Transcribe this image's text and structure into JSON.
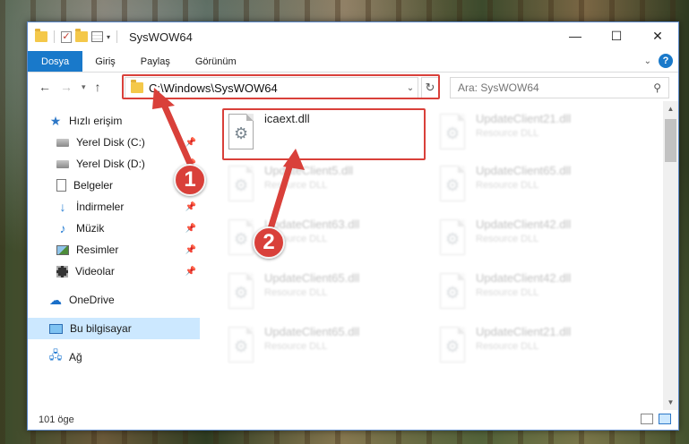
{
  "window": {
    "title": "SysWOW64"
  },
  "window_controls": {
    "minimize": "—",
    "maximize": "☐",
    "close": "✕"
  },
  "ribbon": {
    "tabs": [
      {
        "label": "Dosya"
      },
      {
        "label": "Giriş"
      },
      {
        "label": "Paylaş"
      },
      {
        "label": "Görünüm"
      }
    ],
    "help": "?"
  },
  "address": {
    "path": "C:\\Windows\\SysWOW64"
  },
  "search": {
    "placeholder": "Ara: SysWOW64"
  },
  "sidebar": {
    "items": [
      {
        "label": "Hızlı erişim",
        "icon": "star-icon"
      },
      {
        "label": "Yerel Disk (C:)",
        "icon": "drive-icon",
        "pinned": true
      },
      {
        "label": "Yerel Disk (D:)",
        "icon": "drive-icon",
        "pinned": true
      },
      {
        "label": "Belgeler",
        "icon": "document-icon",
        "pinned": true
      },
      {
        "label": "İndirmeler",
        "icon": "download-icon",
        "pinned": true
      },
      {
        "label": "Müzik",
        "icon": "music-icon",
        "pinned": true
      },
      {
        "label": "Resimler",
        "icon": "pictures-icon",
        "pinned": true
      },
      {
        "label": "Videolar",
        "icon": "videos-icon",
        "pinned": true
      },
      {
        "label": "OneDrive",
        "icon": "cloud-icon"
      },
      {
        "label": "Bu bilgisayar",
        "icon": "computer-icon",
        "selected": true
      },
      {
        "label": "Ağ",
        "icon": "network-icon"
      }
    ]
  },
  "files": [
    {
      "name": "icaext.dll",
      "kind": ""
    },
    {
      "name": "UpdateClient21.dll",
      "kind": "Resource DLL"
    },
    {
      "name": "UpdateClient5.dll",
      "kind": "Resource DLL"
    },
    {
      "name": "UpdateClient65.dll",
      "kind": "Resource DLL"
    },
    {
      "name": "UpdateClient63.dll",
      "kind": "Resource DLL"
    },
    {
      "name": "UpdateClient42.dll",
      "kind": "Resource DLL"
    },
    {
      "name": "UpdateClient65.dll",
      "kind": "Resource DLL"
    },
    {
      "name": "UpdateClient42.dll",
      "kind": "Resource DLL"
    },
    {
      "name": "UpdateClient65.dll",
      "kind": "Resource DLL"
    },
    {
      "name": "UpdateClient21.dll",
      "kind": "Resource DLL"
    }
  ],
  "status": {
    "count": "101 öge"
  },
  "annotations": {
    "step1": "1",
    "step2": "2",
    "highlight_color": "#d9403a"
  }
}
